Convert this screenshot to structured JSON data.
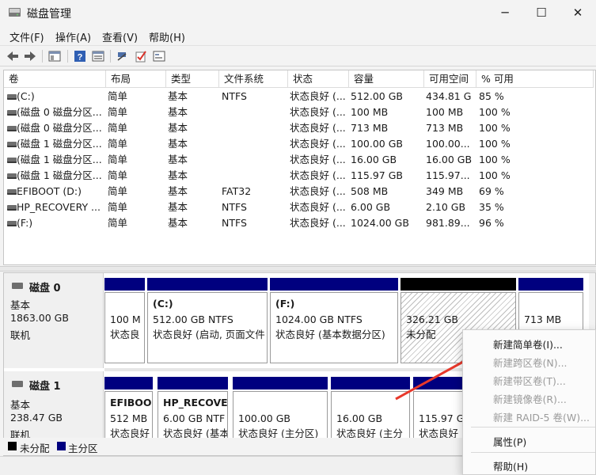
{
  "window": {
    "title": "磁盘管理",
    "minimize": "─",
    "maximize": "☐",
    "close": "✕"
  },
  "menu": [
    "文件(F)",
    "操作(A)",
    "查看(V)",
    "帮助(H)"
  ],
  "toolbar": [
    "back-icon",
    "forward-icon",
    "console-tree-icon",
    "help-icon",
    "properties-icon",
    "connect-icon",
    "check-icon",
    "settings-icon"
  ],
  "volume_table": {
    "headers": [
      "卷",
      "布局",
      "类型",
      "文件系统",
      "状态",
      "容量",
      "可用空间",
      "% 可用"
    ],
    "rows": [
      [
        "(C:)",
        "简单",
        "基本",
        "NTFS",
        "状态良好 (...",
        "512.00 GB",
        "434.81 GB",
        "85 %"
      ],
      [
        "(磁盘 0 磁盘分区...",
        "简单",
        "基本",
        "",
        "状态良好 (...",
        "100 MB",
        "100 MB",
        "100 %"
      ],
      [
        "(磁盘 0 磁盘分区...",
        "简单",
        "基本",
        "",
        "状态良好 (...",
        "713 MB",
        "713 MB",
        "100 %"
      ],
      [
        "(磁盘 1 磁盘分区...",
        "简单",
        "基本",
        "",
        "状态良好 (...",
        "100.00 GB",
        "100.00...",
        "100 %"
      ],
      [
        "(磁盘 1 磁盘分区...",
        "简单",
        "基本",
        "",
        "状态良好 (...",
        "16.00 GB",
        "16.00 GB",
        "100 %"
      ],
      [
        "(磁盘 1 磁盘分区...",
        "简单",
        "基本",
        "",
        "状态良好 (...",
        "115.97 GB",
        "115.97...",
        "100 %"
      ],
      [
        "EFIBOOT (D:)",
        "简单",
        "基本",
        "FAT32",
        "状态良好 (...",
        "508 MB",
        "349 MB",
        "69 %"
      ],
      [
        "HP_RECOVERY ...",
        "简单",
        "基本",
        "NTFS",
        "状态良好 (...",
        "6.00 GB",
        "2.10 GB",
        "35 %"
      ],
      [
        "(F:)",
        "简单",
        "基本",
        "NTFS",
        "状态良好 (...",
        "1024.00 GB",
        "981.89...",
        "96 %"
      ]
    ]
  },
  "disks": [
    {
      "name": "磁盘 0",
      "type": "基本",
      "size": "1863.00 GB",
      "status": "联机",
      "partitions": [
        {
          "label": "",
          "l1": "100 M",
          "l2": "状态良"
        },
        {
          "label": "(C:)",
          "l1": "512.00 GB NTFS",
          "l2": "状态良好 (启动, 页面文件"
        },
        {
          "label": "(F:)",
          "l1": "1024.00 GB NTFS",
          "l2": "状态良好 (基本数据分区)"
        },
        {
          "label": "",
          "l1": "326.21 GB",
          "l2": "未分配"
        },
        {
          "label": "",
          "l1": "713 MB",
          "l2": ""
        }
      ]
    },
    {
      "name": "磁盘 1",
      "type": "基本",
      "size": "238.47 GB",
      "status": "联机",
      "partitions": [
        {
          "label": "EFIBOO",
          "l1": "512 MB",
          "l2": "状态良好"
        },
        {
          "label": "HP_RECOVE",
          "l1": "6.00 GB NTF",
          "l2": "状态良好 (基本"
        },
        {
          "label": "",
          "l1": "100.00 GB",
          "l2": "状态良好 (主分区)"
        },
        {
          "label": "",
          "l1": "16.00 GB",
          "l2": "状态良好 (主分"
        },
        {
          "label": "",
          "l1": "115.97 G",
          "l2": "状态良好"
        }
      ]
    }
  ],
  "legend": [
    {
      "label": "未分配",
      "color": "#000000"
    },
    {
      "label": "主分区",
      "color": "#00007f"
    }
  ],
  "context_menu": {
    "items": [
      {
        "label": "新建简单卷(I)...",
        "enabled": true
      },
      {
        "label": "新建跨区卷(N)...",
        "enabled": false
      },
      {
        "label": "新建带区卷(T)...",
        "enabled": false
      },
      {
        "label": "新建镜像卷(R)...",
        "enabled": false
      },
      {
        "label": "新建 RAID-5 卷(W)...",
        "enabled": false
      },
      {
        "label": "属性(P)",
        "enabled": true
      },
      {
        "label": "帮助(H)",
        "enabled": true
      }
    ]
  },
  "colors": {
    "primary_partition": "#00007f",
    "unallocated": "#000000",
    "annotation_arrow": "#e8382b"
  }
}
